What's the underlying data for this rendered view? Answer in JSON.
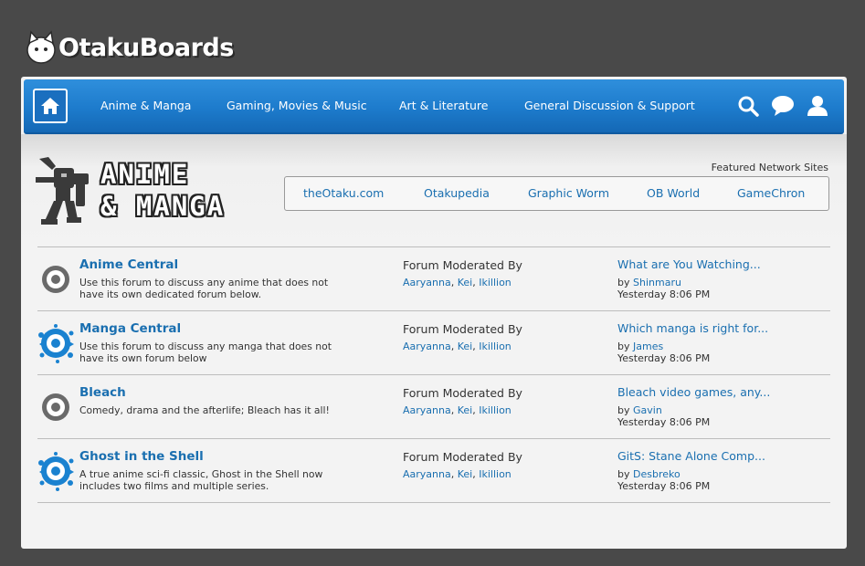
{
  "site": {
    "logo_text": "OtakuBoards"
  },
  "nav": {
    "home_label": "Home",
    "links": [
      "Anime & Manga",
      "Gaming, Movies & Music",
      "Art & Literature",
      "General Discussion & Support"
    ],
    "icons": [
      "search-icon",
      "chat-bubble-icon",
      "user-icon"
    ]
  },
  "section": {
    "title_line1": "ANIME",
    "title_line2": "& MANGA",
    "featured_label": "Featured Network Sites",
    "featured_sites": [
      "theOtaku.com",
      "Otakupedia",
      "Graphic Worm",
      "OB World",
      "GameChron"
    ]
  },
  "forums": [
    {
      "icon": "target-icon-gray",
      "title": "Anime Central",
      "description": "Use this forum to discuss any anime that does not have its own dedicated forum below.",
      "mod_label": "Forum Moderated By",
      "mods": [
        "Aaryanna",
        "Kei",
        "Ikillion"
      ],
      "last_post_title": "What are You Watching...",
      "last_post_by_prefix": "by",
      "last_post_user": "Shinmaru",
      "last_post_time": "Yesterday 8:06 PM"
    },
    {
      "icon": "target-icon-blue-splash",
      "title": "Manga Central",
      "description": "Use this forum to discuss any manga that does not have its own forum below",
      "mod_label": "Forum Moderated By",
      "mods": [
        "Aaryanna",
        "Kei",
        "Ikillion"
      ],
      "last_post_title": "Which manga is right for...",
      "last_post_by_prefix": "by",
      "last_post_user": "James",
      "last_post_time": "Yesterday 8:06 PM"
    },
    {
      "icon": "target-icon-gray",
      "title": "Bleach",
      "description": "Comedy, drama and the afterlife; Bleach has it all!",
      "mod_label": "Forum Moderated By",
      "mods": [
        "Aaryanna",
        "Kei",
        "Ikillion"
      ],
      "last_post_title": "Bleach video games, any...",
      "last_post_by_prefix": "by",
      "last_post_user": "Gavin",
      "last_post_time": "Yesterday 8:06 PM"
    },
    {
      "icon": "target-icon-blue-splash",
      "title": "Ghost in the Shell",
      "description": "A true anime sci-fi classic, Ghost in the Shell now includes two films and multiple series.",
      "mod_label": "Forum Moderated By",
      "mods": [
        "Aaryanna",
        "Kei",
        "Ikillion"
      ],
      "last_post_title": "GitS: Stane Alone Comp...",
      "last_post_by_prefix": "by",
      "last_post_user": "Desbreko",
      "last_post_time": "Yesterday 8:06 PM"
    }
  ],
  "colors": {
    "nav_blue": "#1d7bcc",
    "link_blue": "#1a6fb0",
    "background": "#494949"
  }
}
